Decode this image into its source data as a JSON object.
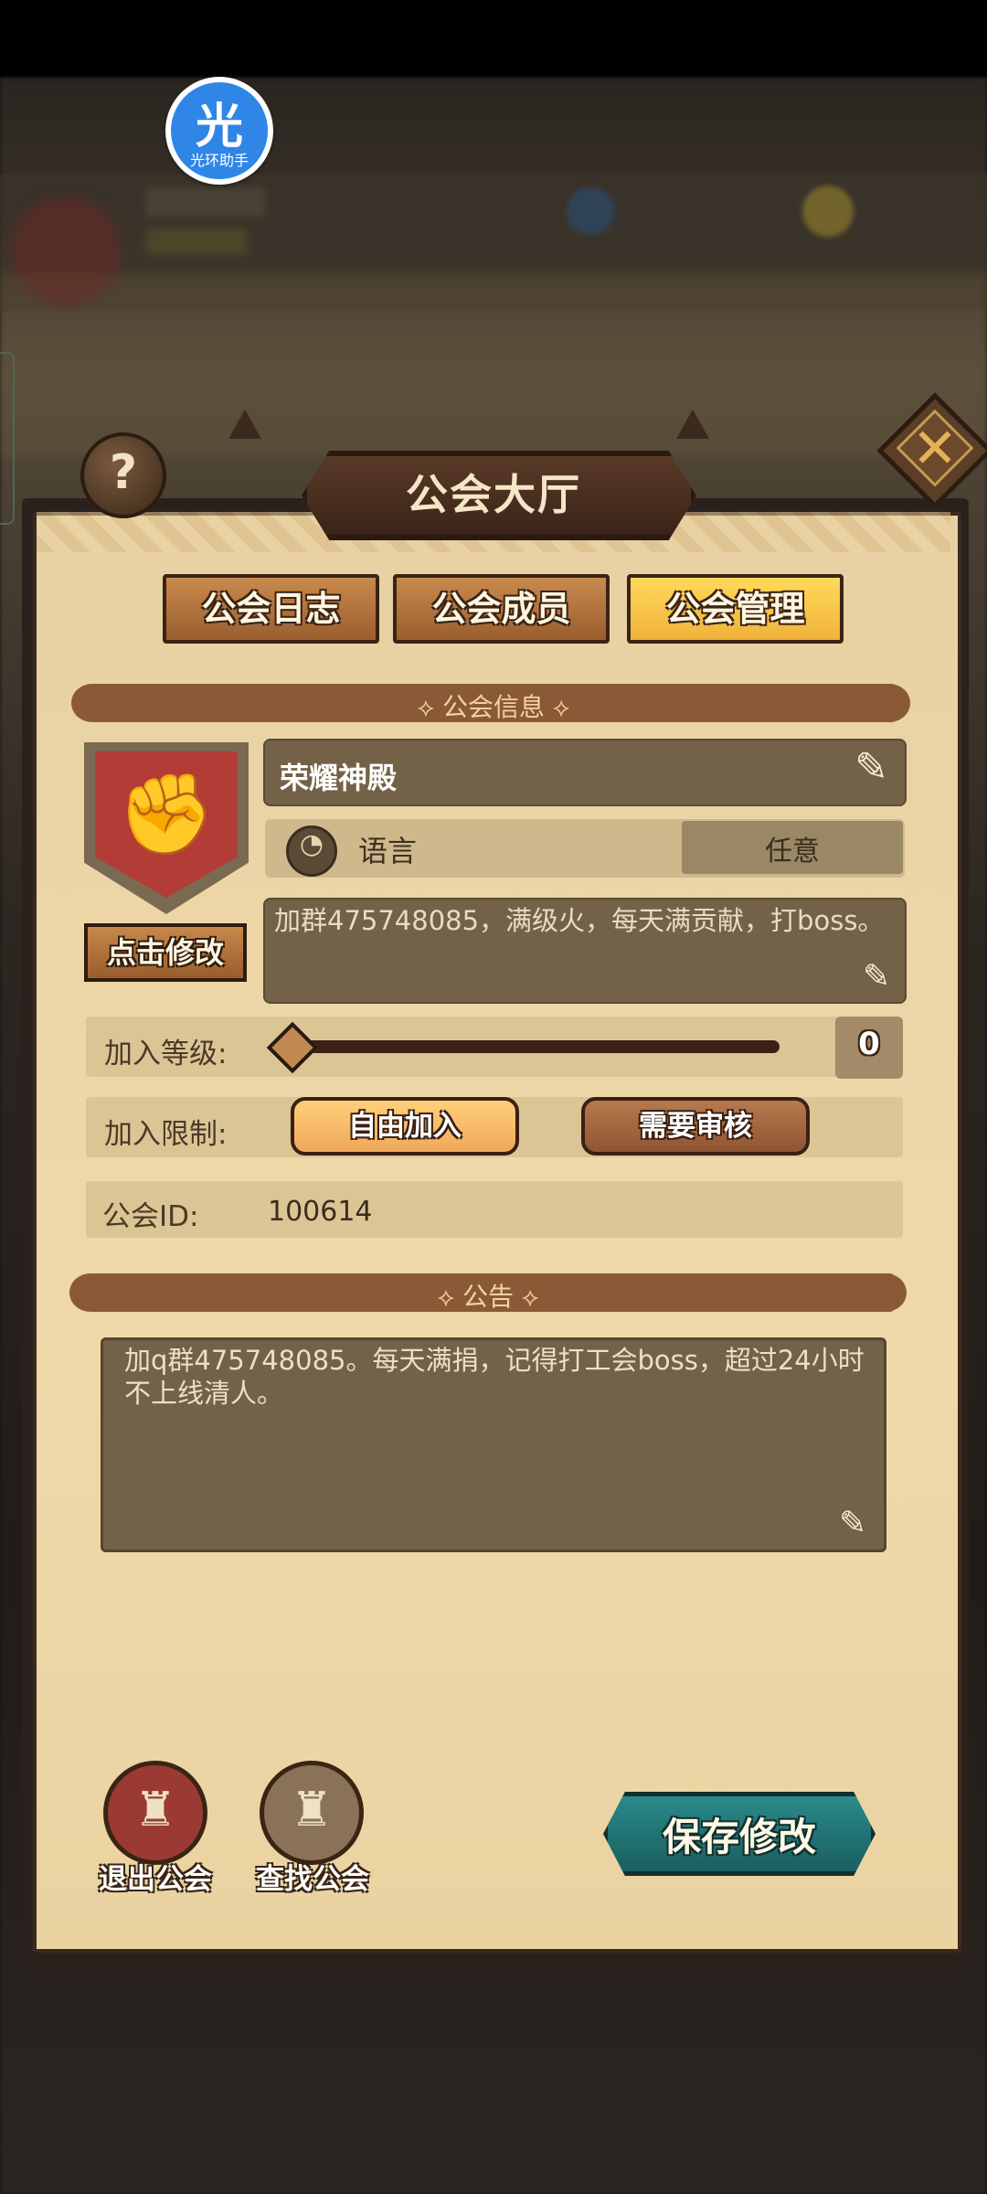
{
  "helper": {
    "glyph": "光",
    "label": "光环助手"
  },
  "dialog": {
    "title": "公会大厅",
    "help_glyph": "?",
    "close_glyph": "✕"
  },
  "tabs": [
    {
      "label": "公会日志",
      "active": false
    },
    {
      "label": "公会成员",
      "active": false
    },
    {
      "label": "公会管理",
      "active": true
    }
  ],
  "guild_info": {
    "section_title": "公会信息",
    "emblem_edit_label": "点击修改",
    "name": "荣耀神殿",
    "language_label": "语言",
    "language_value": "任意",
    "description": "加群475748085，满级火，每天满贡献，打boss。",
    "join_level_label": "加入等级:",
    "join_level_value": "0",
    "join_limit_label": "加入限制:",
    "join_options": [
      {
        "label": "自由加入",
        "selected": true
      },
      {
        "label": "需要审核",
        "selected": false
      }
    ],
    "guild_id_label": "公会ID:",
    "guild_id_value": "100614"
  },
  "notice": {
    "section_title": "公告",
    "text": "加q群475748085。每天满捐，记得打工会boss，超过24小时不上线清人。"
  },
  "actions": {
    "leave_label": "退出公会",
    "find_label": "查找公会",
    "save_label": "保存修改"
  }
}
